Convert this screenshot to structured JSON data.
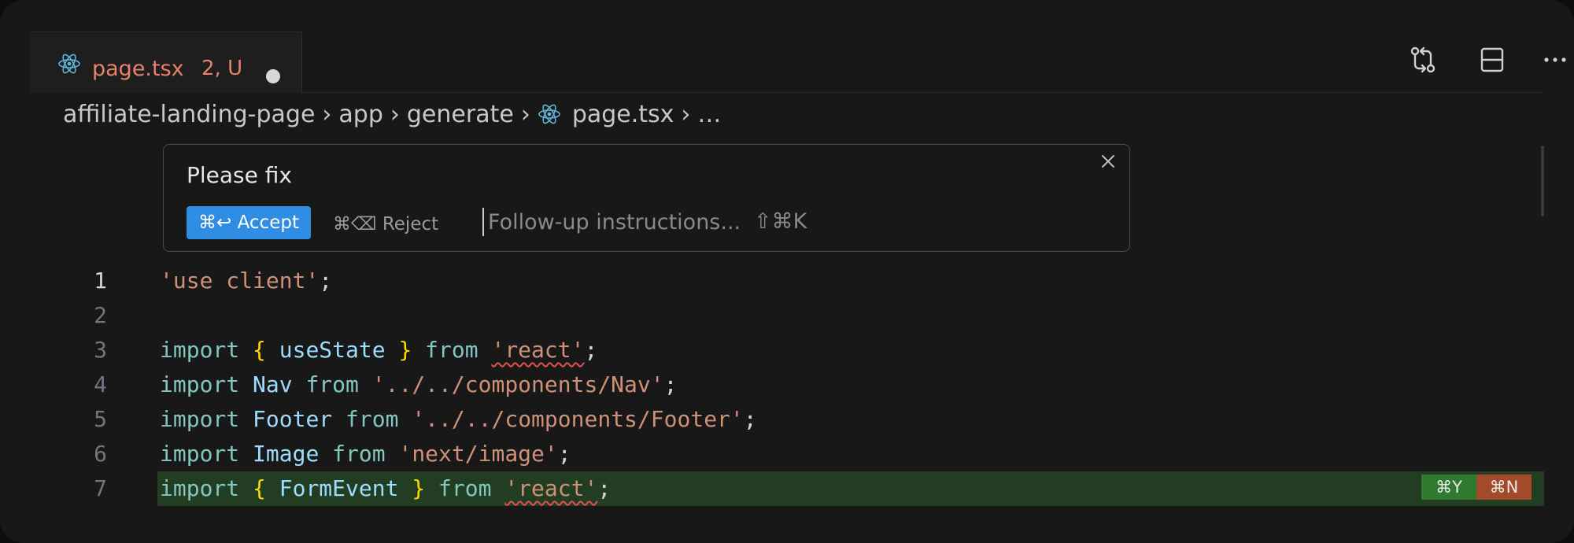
{
  "tab": {
    "filename": "page.tsx",
    "status": "2, U"
  },
  "breadcrumb": {
    "items": [
      "affiliate-landing-page",
      "app",
      "generate",
      "page.tsx",
      "…"
    ],
    "separator": "›"
  },
  "prompt_widget": {
    "prompt": "Please fix",
    "accept_label": "⌘↩ Accept",
    "reject_label": "⌘⌫ Reject",
    "followup_placeholder": "Follow-up instructions...",
    "followup_shortcut": "⇧⌘K",
    "close_icon": "close-icon"
  },
  "editor": {
    "line_numbers": [
      "1",
      "2",
      "3",
      "4",
      "5",
      "6",
      "7"
    ],
    "lines": [
      {
        "t": [
          [
            "str",
            "'use client'"
          ],
          [
            "punct",
            ";"
          ]
        ]
      },
      {
        "t": []
      },
      {
        "t": [
          [
            "kw",
            "import"
          ],
          [
            "punct",
            " "
          ],
          [
            "brace",
            "{"
          ],
          [
            "punct",
            " "
          ],
          [
            "id",
            "useState"
          ],
          [
            "punct",
            " "
          ],
          [
            "brace",
            "}"
          ],
          [
            "punct",
            " "
          ],
          [
            "kw",
            "from"
          ],
          [
            "punct",
            " "
          ],
          [
            "str-sq",
            "'react'"
          ],
          [
            "punct",
            ";"
          ]
        ]
      },
      {
        "t": [
          [
            "kw",
            "import"
          ],
          [
            "punct",
            " "
          ],
          [
            "id",
            "Nav"
          ],
          [
            "punct",
            " "
          ],
          [
            "kw",
            "from"
          ],
          [
            "punct",
            " "
          ],
          [
            "str",
            "'../../components/Nav'"
          ],
          [
            "punct",
            ";"
          ]
        ]
      },
      {
        "t": [
          [
            "kw",
            "import"
          ],
          [
            "punct",
            " "
          ],
          [
            "id",
            "Footer"
          ],
          [
            "punct",
            " "
          ],
          [
            "kw",
            "from"
          ],
          [
            "punct",
            " "
          ],
          [
            "str",
            "'../../components/Footer'"
          ],
          [
            "punct",
            ";"
          ]
        ]
      },
      {
        "t": [
          [
            "kw",
            "import"
          ],
          [
            "punct",
            " "
          ],
          [
            "id",
            "Image"
          ],
          [
            "punct",
            " "
          ],
          [
            "kw",
            "from"
          ],
          [
            "punct",
            " "
          ],
          [
            "str",
            "'next/image'"
          ],
          [
            "punct",
            ";"
          ]
        ]
      },
      {
        "t": [
          [
            "kw",
            "import"
          ],
          [
            "punct",
            " "
          ],
          [
            "brace",
            "{"
          ],
          [
            "punct",
            " "
          ],
          [
            "id",
            "FormEvent"
          ],
          [
            "punct",
            " "
          ],
          [
            "brace",
            "}"
          ],
          [
            "punct",
            " "
          ],
          [
            "kw",
            "from"
          ],
          [
            "punct",
            " "
          ],
          [
            "str-sq",
            "'react'"
          ],
          [
            "punct",
            ";"
          ]
        ],
        "added": true
      }
    ],
    "accept_line_shortcut": "⌘Y",
    "reject_line_shortcut": "⌘N"
  },
  "toolbar": {
    "icons": [
      "compare-changes-icon",
      "split-editor-icon",
      "more-actions-icon"
    ]
  },
  "colors": {
    "accent": "#2f8de4",
    "tab_modified": "#e8806b",
    "added_line_bg": "#223d21",
    "accept_badge": "#2f7a2f",
    "reject_badge": "#a34a2a"
  }
}
